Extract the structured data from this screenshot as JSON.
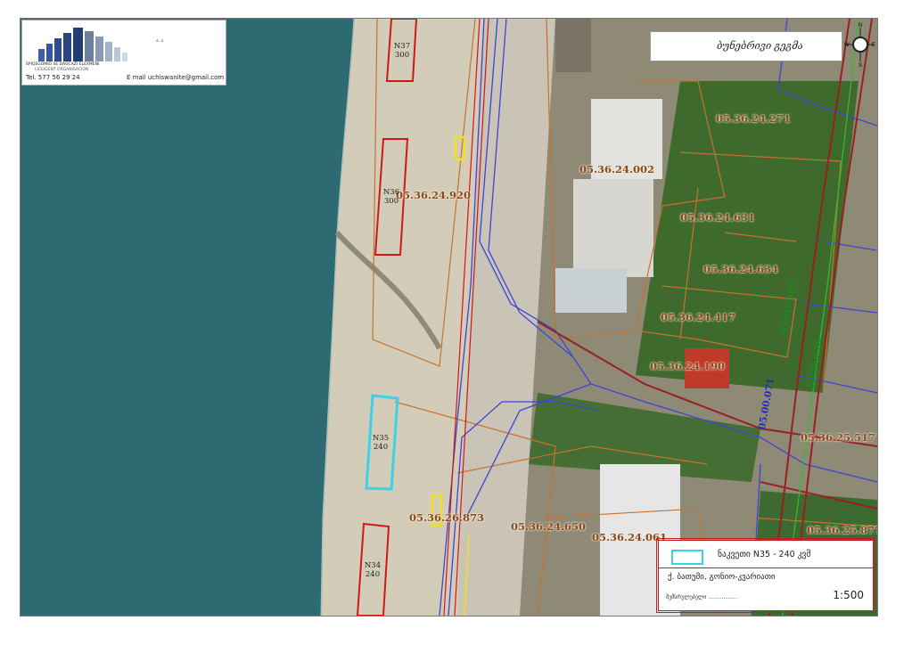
{
  "scale": "1:500",
  "colors": {
    "sea": "#2e6a72",
    "beach": "#cfc7b1",
    "cadastre": "#c9722e",
    "utility": "#3e44d8",
    "boundary": "#d01818",
    "selected_lot": "#3fd0e8",
    "kiosk": "#f0e020",
    "green_line": "#2fbf2f"
  },
  "logo": {
    "small_text": "ა. ა",
    "line1": "SPIQEGOMIO SE DAOCAZI ELEXMENI",
    "line2": "LICEIGENT ORGANISACION",
    "tel": "Tel.  577 56 29 24",
    "mail": "E mail   uchiswanite@gmail.com"
  },
  "north_label": "ბუნებრივი გეგმა",
  "compass": {
    "n": "N",
    "s": "S",
    "e": "E",
    "w": "W"
  },
  "parcels": [
    "05.36.24.271",
    "05.36.24.002",
    "05.36.24.920",
    "05.36.24.631",
    "05.36.24.634",
    "05.36.24.417",
    "05.36.24.190",
    "05.36.25.517",
    "05.36.26.873",
    "05.36.24.650",
    "05.36.24.061",
    "05.36.25.877"
  ],
  "roads": [
    {
      "label": "01-01-303",
      "color": "#1a8a1a"
    },
    {
      "label": "22.00.076",
      "color": "#1a8a1a"
    },
    {
      "label": "05.00.071",
      "color": "#1e2ec0"
    }
  ],
  "lots": [
    {
      "no": "N37",
      "area": "300"
    },
    {
      "no": "N36",
      "area": "300"
    },
    {
      "no": "N35",
      "area": "240"
    },
    {
      "no": "N34",
      "area": "240"
    }
  ],
  "legend": {
    "title": "ნაკვეთი  N35 - 240  კვმ",
    "address": "ქ. ბათუმი, გონიო-კვარიათი",
    "signature": "შემსრულებელი ................."
  }
}
